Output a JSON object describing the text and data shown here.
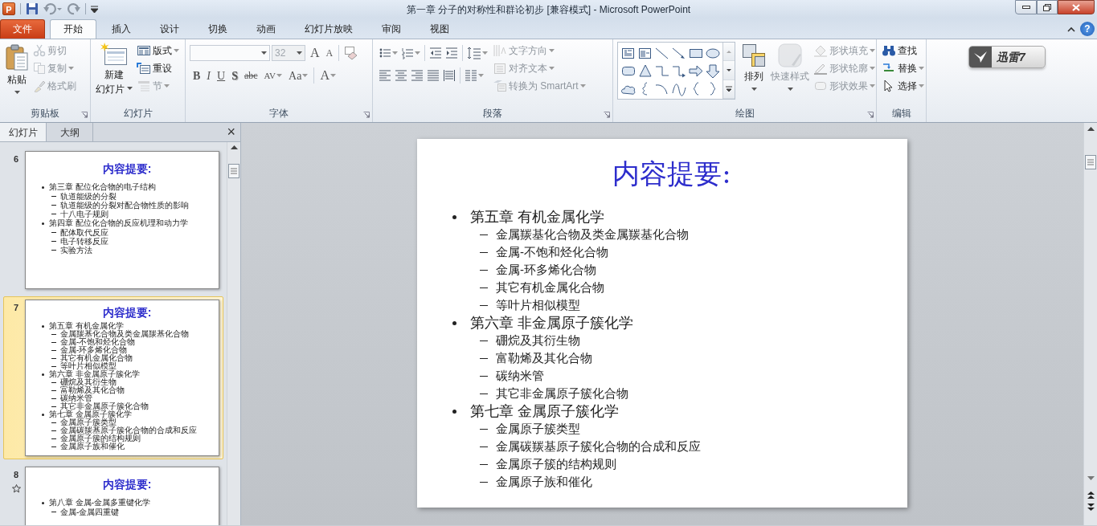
{
  "window": {
    "logo": "P",
    "title": "第一章  分子的对称性和群论初步 [兼容模式]  -  Microsoft PowerPoint"
  },
  "tabs": [
    {
      "label": "文件",
      "kind": "file",
      "selected": false
    },
    {
      "label": "开始",
      "kind": "tab",
      "selected": true
    },
    {
      "label": "插入",
      "kind": "tab",
      "selected": false
    },
    {
      "label": "设计",
      "kind": "tab",
      "selected": false
    },
    {
      "label": "切换",
      "kind": "tab",
      "selected": false
    },
    {
      "label": "动画",
      "kind": "tab",
      "selected": false
    },
    {
      "label": "幻灯片放映",
      "kind": "tab",
      "selected": false
    },
    {
      "label": "审阅",
      "kind": "tab",
      "selected": false
    },
    {
      "label": "视图",
      "kind": "tab",
      "selected": false
    }
  ],
  "help": "?",
  "ribbon": {
    "groups": [
      {
        "label": "剪贴板",
        "launcher": true,
        "columns": [
          {
            "kind": "large",
            "items": [
              {
                "lines": [
                  "粘贴"
                ],
                "menu": true,
                "disabled": false
              }
            ]
          },
          {
            "kind": "stack",
            "items": [
              {
                "label": "剪切",
                "menu": false,
                "disabled": true
              },
              {
                "label": "复制",
                "menu": true,
                "disabled": true
              },
              {
                "label": "格式刷",
                "menu": false,
                "disabled": true
              }
            ]
          }
        ]
      },
      {
        "label": "幻灯片",
        "launcher": false,
        "columns": [
          {
            "kind": "large",
            "items": [
              {
                "lines": [
                  "新建",
                  "幻灯片"
                ],
                "menu": true,
                "disabled": false
              }
            ]
          },
          {
            "kind": "stack",
            "items": [
              {
                "label": "版式",
                "menu": true,
                "disabled": false
              },
              {
                "label": "重设",
                "menu": false,
                "disabled": false
              },
              {
                "label": "节",
                "menu": true,
                "disabled": true
              }
            ]
          }
        ]
      },
      {
        "label": "字体",
        "launcher": true,
        "columns": [
          {
            "kind": "rows",
            "rows": [
              [
                [
                  {
                    "kind": "combo",
                    "disabled": false
                  },
                  {
                    "kind": "combo",
                    "value": "32",
                    "disabled": true
                  },
                  {
                    "kind": "glyph",
                    "label": "A",
                    "menu": false,
                    "disabled": false
                  },
                  {
                    "kind": "glyph",
                    "label": "A",
                    "menu": false,
                    "disabled": false
                  }
                ],
                [
                  {
                    "kind": "icon",
                    "menu": false,
                    "disabled": false
                  }
                ]
              ],
              [
                [
                  {
                    "kind": "glyph",
                    "label": "B",
                    "menu": false,
                    "disabled": false
                  },
                  {
                    "kind": "glyph",
                    "label": "I",
                    "menu": false,
                    "disabled": false
                  },
                  {
                    "kind": "glyph",
                    "label": "U",
                    "menu": false,
                    "disabled": false
                  },
                  {
                    "kind": "glyph",
                    "label": "S",
                    "menu": false,
                    "disabled": false
                  },
                  {
                    "kind": "glyph",
                    "label": "abc",
                    "menu": false,
                    "disabled": false
                  },
                  {
                    "kind": "glyph",
                    "label": "AV",
                    "menu": true,
                    "disabled": false
                  },
                  {
                    "kind": "glyph",
                    "label": "Aa",
                    "menu": true,
                    "disabled": false
                  }
                ],
                [
                  {
                    "kind": "glyph",
                    "label": "A",
                    "menu": true,
                    "disabled": false
                  }
                ]
              ]
            ]
          }
        ]
      },
      {
        "label": "段落",
        "launcher": true,
        "columns": [
          {
            "kind": "rows",
            "rows": [
              [
                [
                  {
                    "kind": "icon",
                    "menu": true,
                    "disabled": false
                  },
                  {
                    "kind": "icon",
                    "menu": true,
                    "disabled": false
                  }
                ],
                [
                  {
                    "kind": "icon",
                    "menu": false,
                    "disabled": false
                  },
                  {
                    "kind": "icon",
                    "menu": false,
                    "disabled": false
                  }
                ],
                [
                  {
                    "kind": "icon",
                    "menu": true,
                    "disabled": false
                  }
                ]
              ],
              [
                [
                  {
                    "kind": "icon",
                    "menu": false,
                    "disabled": false
                  },
                  {
                    "kind": "icon",
                    "menu": false,
                    "disabled": false
                  },
                  {
                    "kind": "icon",
                    "menu": false,
                    "disabled": false
                  },
                  {
                    "kind": "icon",
                    "menu": false,
                    "disabled": false
                  },
                  {
                    "kind": "icon",
                    "menu": false,
                    "disabled": false
                  }
                ],
                [
                  {
                    "kind": "icon",
                    "menu": true,
                    "disabled": false
                  }
                ]
              ]
            ]
          },
          {
            "kind": "stack",
            "items": [
              {
                "label": "文字方向",
                "menu": true,
                "disabled": true
              },
              {
                "label": "对齐文本",
                "menu": true,
                "disabled": true
              },
              {
                "label": "转换为 SmartArt",
                "menu": true,
                "disabled": true
              }
            ]
          }
        ]
      },
      {
        "label": "绘图",
        "launcher": true,
        "columns": [
          {
            "kind": "gallery"
          },
          {
            "kind": "large",
            "items": [
              {
                "lines": [
                  "排列"
                ],
                "menu": true,
                "disabled": false
              }
            ]
          },
          {
            "kind": "large",
            "items": [
              {
                "lines": [
                  "快速样式"
                ],
                "menu": true,
                "disabled": true
              }
            ]
          },
          {
            "kind": "stack",
            "items": [
              {
                "label": "形状填充",
                "menu": true,
                "disabled": true
              },
              {
                "label": "形状轮廓",
                "menu": true,
                "disabled": true
              },
              {
                "label": "形状效果",
                "menu": true,
                "disabled": true
              }
            ]
          }
        ]
      },
      {
        "label": "编辑",
        "launcher": false,
        "columns": [
          {
            "kind": "stack",
            "items": [
              {
                "label": "查找",
                "menu": false,
                "disabled": false
              },
              {
                "label": "替换",
                "menu": true,
                "disabled": false
              },
              {
                "label": "选择",
                "menu": true,
                "disabled": false
              }
            ]
          }
        ]
      }
    ]
  },
  "addin": {
    "label": "迅雷7"
  },
  "panel": {
    "tabs": [
      {
        "label": "幻灯片",
        "selected": true
      },
      {
        "label": "大纲",
        "selected": false
      }
    ],
    "close": "×"
  },
  "thumbnails": [
    {
      "number": "6",
      "selected": false,
      "animated": false,
      "title": "内容提要:",
      "items": [
        {
          "text": "第三章 配位化合物的电子结构",
          "children": [
            {
              "text": "轨道能级的分裂"
            },
            {
              "text": "轨道能级的分裂对配合物性质的影响"
            },
            {
              "text": "十八电子规则"
            }
          ]
        },
        {
          "text": "第四章 配位化合物的反应机理和动力学",
          "children": [
            {
              "text": "配体取代反应"
            },
            {
              "text": "电子转移反应"
            },
            {
              "text": "实验方法"
            }
          ]
        }
      ]
    },
    {
      "number": "7",
      "selected": true,
      "animated": false,
      "title": "内容提要:",
      "items": [
        {
          "text": "第五章  有机金属化学",
          "children": [
            {
              "text": "金属羰基化合物及类金属羰基化合物"
            },
            {
              "text": "金属-不饱和烃化合物"
            },
            {
              "text": "金属-环多烯化合物"
            },
            {
              "text": "其它有机金属化合物"
            },
            {
              "text": "等叶片相似模型"
            }
          ]
        },
        {
          "text": "第六章  非金属原子簇化学",
          "children": [
            {
              "text": "硼烷及其衍生物"
            },
            {
              "text": "富勒烯及其化合物"
            },
            {
              "text": "碳纳米管"
            },
            {
              "text": "其它非金属原子簇化合物"
            }
          ]
        },
        {
          "text": "第七章  金属原子簇化学",
          "children": [
            {
              "text": "金属原子簇类型"
            },
            {
              "text": "金属碳羰基原子簇化合物的合成和反应"
            },
            {
              "text": "金属原子簇的结构规则"
            },
            {
              "text": "金属原子族和催化"
            }
          ]
        }
      ]
    },
    {
      "number": "8",
      "selected": false,
      "animated": true,
      "title": "内容提要:",
      "items": [
        {
          "text": "第八章 金属-金属多重键化学",
          "children": [
            {
              "text": "金属-金属四重键"
            }
          ]
        }
      ]
    }
  ],
  "slide": {
    "title": "内容提要:",
    "items": [
      {
        "text": "第五章  有机金属化学",
        "children": [
          {
            "text": "金属羰基化合物及类金属羰基化合物"
          },
          {
            "text": "金属-不饱和烃化合物"
          },
          {
            "text": "金属-环多烯化合物"
          },
          {
            "text": "其它有机金属化合物"
          },
          {
            "text": "等叶片相似模型"
          }
        ]
      },
      {
        "text": "第六章  非金属原子簇化学",
        "children": [
          {
            "text": "硼烷及其衍生物"
          },
          {
            "text": "富勒烯及其化合物"
          },
          {
            "text": "碳纳米管"
          },
          {
            "text": "其它非金属原子簇化合物"
          }
        ]
      },
      {
        "text": "第七章  金属原子簇化学",
        "children": [
          {
            "text": "金属原子簇类型"
          },
          {
            "text": "金属碳羰基原子簇化合物的合成和反应"
          },
          {
            "text": "金属原子簇的结构规则"
          },
          {
            "text": "金属原子族和催化"
          }
        ]
      }
    ]
  }
}
